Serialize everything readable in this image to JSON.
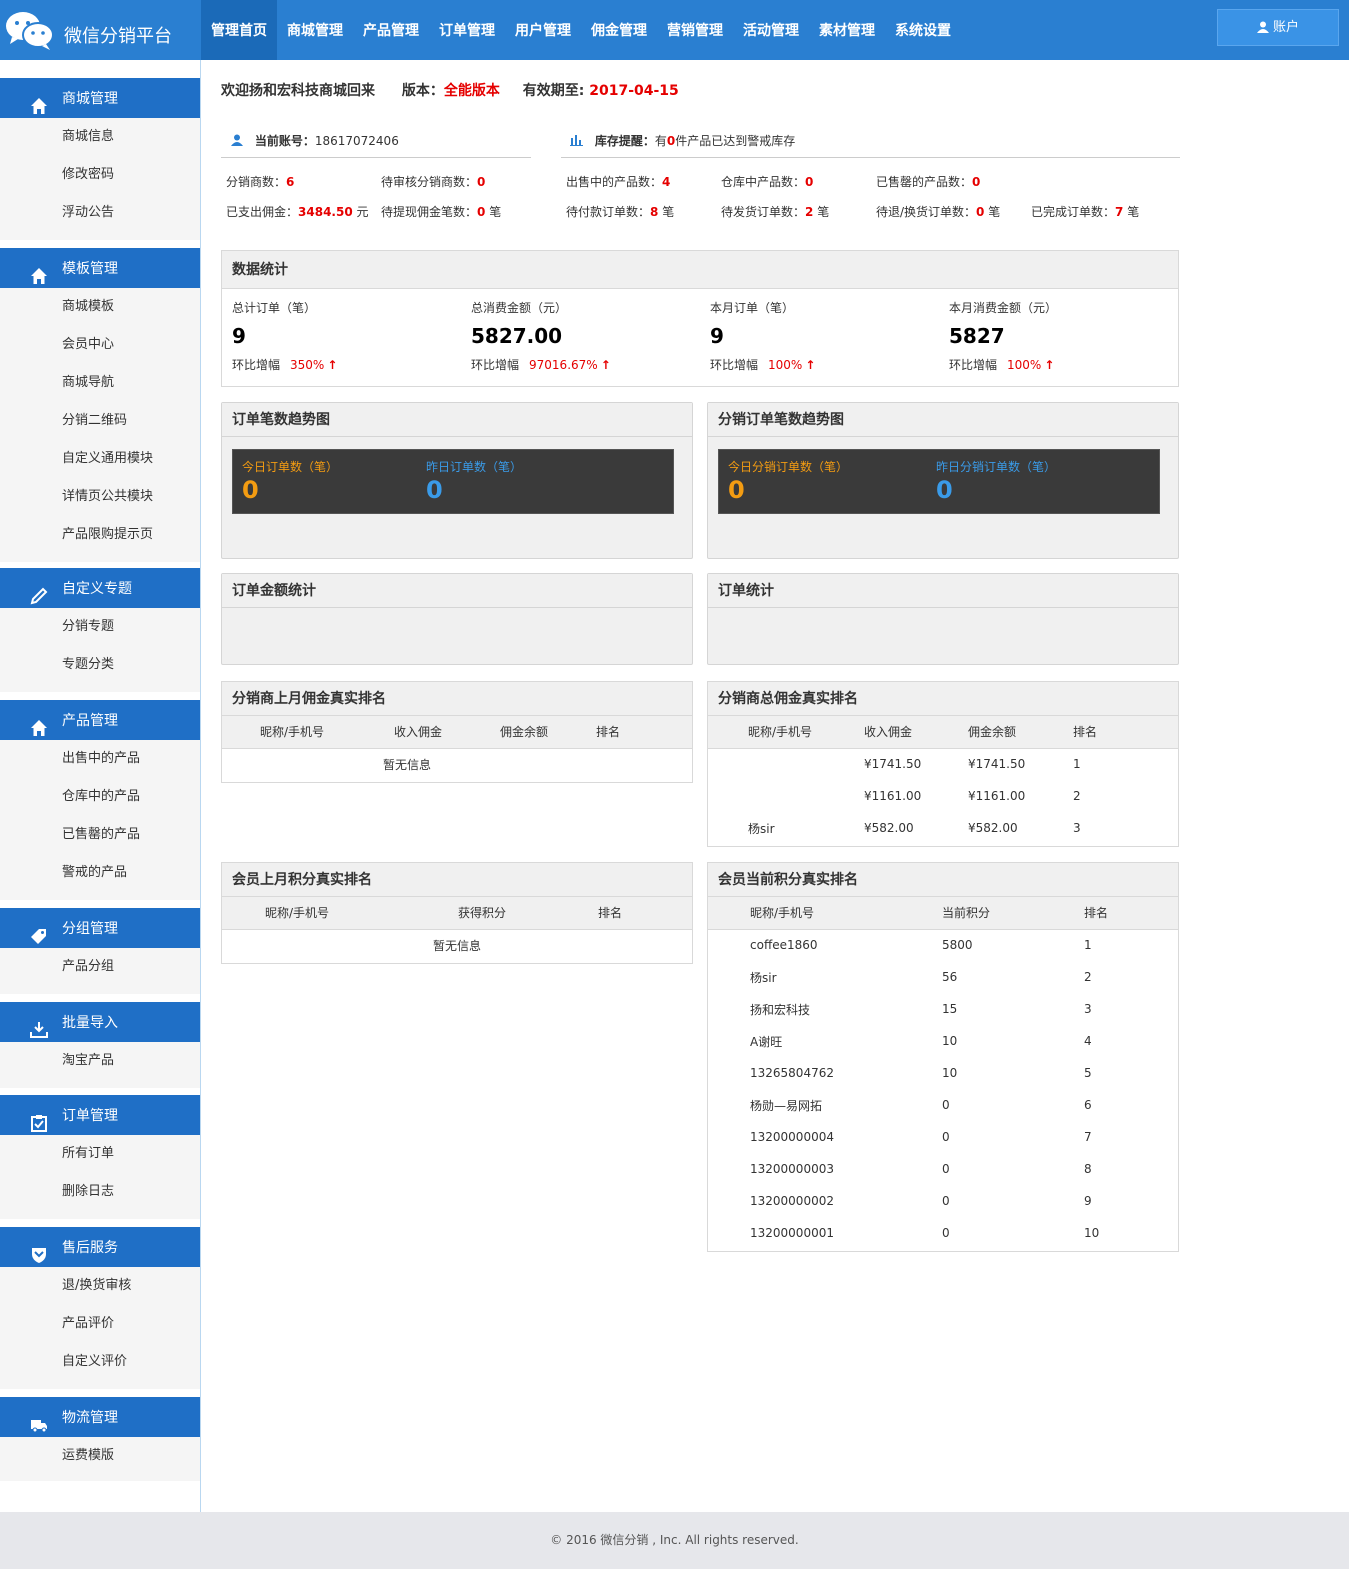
{
  "app": {
    "title": "微信分销平台",
    "account_label": "账户"
  },
  "nav": [
    "管理首页",
    "商城管理",
    "产品管理",
    "订单管理",
    "用户管理",
    "佣金管理",
    "营销管理",
    "活动管理",
    "素材管理",
    "系统设置"
  ],
  "sidebar": [
    {
      "title": "商城管理",
      "icon": "home-icon",
      "items": [
        "商城信息",
        "修改密码",
        "浮动公告"
      ]
    },
    {
      "title": "模板管理",
      "icon": "home-icon",
      "items": [
        "商城模板",
        "会员中心",
        "商城导航",
        "分销二维码",
        "自定义通用模块",
        "详情页公共模块",
        "产品限购提示页"
      ]
    },
    {
      "title": "自定义专题",
      "icon": "pencil-icon",
      "items": [
        "分销专题",
        "专题分类"
      ]
    },
    {
      "title": "产品管理",
      "icon": "home-icon",
      "items": [
        "出售中的产品",
        "仓库中的产品",
        "已售罄的产品",
        "警戒的产品"
      ]
    },
    {
      "title": "分组管理",
      "icon": "tag-icon",
      "items": [
        "产品分组"
      ]
    },
    {
      "title": "批量导入",
      "icon": "import-icon",
      "items": [
        "淘宝产品"
      ]
    },
    {
      "title": "订单管理",
      "icon": "clipboard-icon",
      "items": [
        "所有订单",
        "删除日志"
      ]
    },
    {
      "title": "售后服务",
      "icon": "shield-icon",
      "items": [
        "退/换货审核",
        "产品评价",
        "自定义评价"
      ]
    },
    {
      "title": "物流管理",
      "icon": "truck-icon",
      "items": [
        "运费模版"
      ]
    }
  ],
  "welcome": {
    "text": "欢迎扬和宏科技商城回来",
    "version_label": "版本：",
    "version": "全能版本",
    "expire_label": "有效期至:",
    "expire": "2017-04-15"
  },
  "account_info": {
    "label": "当前账号：",
    "value": "18617072406"
  },
  "stock_info": {
    "label": "库存提醒：",
    "pre": "有",
    "count": "0",
    "post": "件产品已达到警戒库存"
  },
  "stats": [
    [
      {
        "label": "分销商数：",
        "value": "6",
        "unit": ""
      },
      {
        "label": "待审核分销商数：",
        "value": "0",
        "unit": ""
      },
      {
        "label": "出售中的产品数：",
        "value": "4",
        "unit": ""
      },
      {
        "label": "仓库中产品数：",
        "value": "0",
        "unit": ""
      },
      {
        "label": "已售罄的产品数：",
        "value": "0",
        "unit": ""
      }
    ],
    [
      {
        "label": "已支出佣金：",
        "value": "3484.50",
        "unit": " 元"
      },
      {
        "label": "待提现佣金笔数：",
        "value": "0",
        "unit": " 笔"
      },
      {
        "label": "待付款订单数：",
        "value": "8",
        "unit": " 笔"
      },
      {
        "label": "待发货订单数：",
        "value": "2",
        "unit": " 笔"
      },
      {
        "label": "待退/换货订单数：",
        "value": "0",
        "unit": " 笔"
      },
      {
        "label": "已完成订单数：",
        "value": "7",
        "unit": " 笔"
      }
    ]
  ],
  "data_stats": {
    "title": "数据统计",
    "growth_label": "环比增幅",
    "kpis": [
      {
        "label": "总计订单（笔）",
        "value": "9",
        "growth": "350%"
      },
      {
        "label": "总消费金额（元）",
        "value": "5827.00",
        "growth": "97016.67%"
      },
      {
        "label": "本月订单（笔）",
        "value": "9",
        "growth": "100%"
      },
      {
        "label": "本月消费金额（元）",
        "value": "5827",
        "growth": "100%"
      }
    ]
  },
  "trend_panels": [
    {
      "title": "订单笔数趋势图",
      "a_label": "今日订单数（笔）",
      "a_value": "0",
      "b_label": "昨日订单数（笔）",
      "b_value": "0"
    },
    {
      "title": "分销订单笔数趋势图",
      "a_label": "今日分销订单数（笔）",
      "a_value": "0",
      "b_label": "昨日分销订单数（笔）",
      "b_value": "0"
    }
  ],
  "amount_panel": {
    "title": "订单金额统计"
  },
  "order_panel": {
    "title": "订单统计"
  },
  "dist_last_month": {
    "title": "分销商上月佣金真实排名",
    "headers": [
      "昵称/手机号",
      "收入佣金",
      "佣金余额",
      "排名"
    ],
    "empty": "暂无信息"
  },
  "dist_total": {
    "title": "分销商总佣金真实排名",
    "headers": [
      "昵称/手机号",
      "收入佣金",
      "佣金余额",
      "排名"
    ],
    "rows": [
      [
        "",
        "¥1741.50",
        "¥1741.50",
        "1"
      ],
      [
        "",
        "¥1161.00",
        "¥1161.00",
        "2"
      ],
      [
        "杨sir",
        "¥582.00",
        "¥582.00",
        "3"
      ]
    ]
  },
  "member_last_month": {
    "title": "会员上月积分真实排名",
    "headers": [
      "昵称/手机号",
      "获得积分",
      "排名"
    ],
    "empty": "暂无信息"
  },
  "member_current": {
    "title": "会员当前积分真实排名",
    "headers": [
      "昵称/手机号",
      "当前积分",
      "排名"
    ],
    "rows": [
      [
        "coffee1860",
        "5800",
        "1"
      ],
      [
        "杨sir",
        "56",
        "2"
      ],
      [
        "扬和宏科技",
        "15",
        "3"
      ],
      [
        "A谢旺",
        "10",
        "4"
      ],
      [
        "13265804762",
        "10",
        "5"
      ],
      [
        "杨勋—易网拓",
        "0",
        "6"
      ],
      [
        "13200000004",
        "0",
        "7"
      ],
      [
        "13200000003",
        "0",
        "8"
      ],
      [
        "13200000002",
        "0",
        "9"
      ],
      [
        "13200000001",
        "0",
        "10"
      ]
    ]
  },
  "footer": "© 2016 微信分销 , Inc. All rights reserved.",
  "colors": {
    "primary": "#2a7fd1",
    "sidebar_head": "#1f6fc6",
    "highlight_red": "#e50000",
    "orange": "#f39c12",
    "blue": "#3a9be8"
  }
}
